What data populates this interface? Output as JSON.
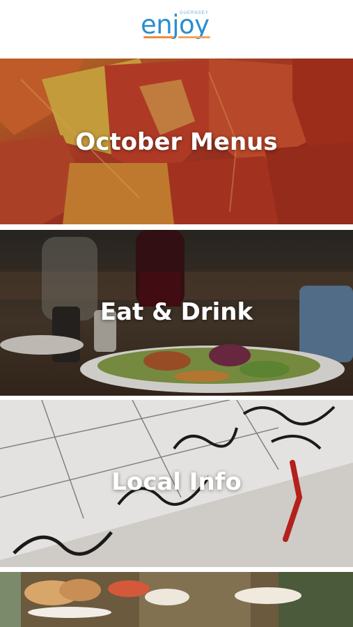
{
  "header": {
    "logo_text": "enjoy",
    "logo_subtext": "GUERNSEY"
  },
  "cards": [
    {
      "title": "October Menus"
    },
    {
      "title": "Eat & Drink"
    },
    {
      "title": "Local Info"
    },
    {
      "title": ""
    }
  ],
  "colors": {
    "brand_blue": "#2a8fcf",
    "logo_orange": "#f08a3c",
    "separator": "#ffffff"
  }
}
